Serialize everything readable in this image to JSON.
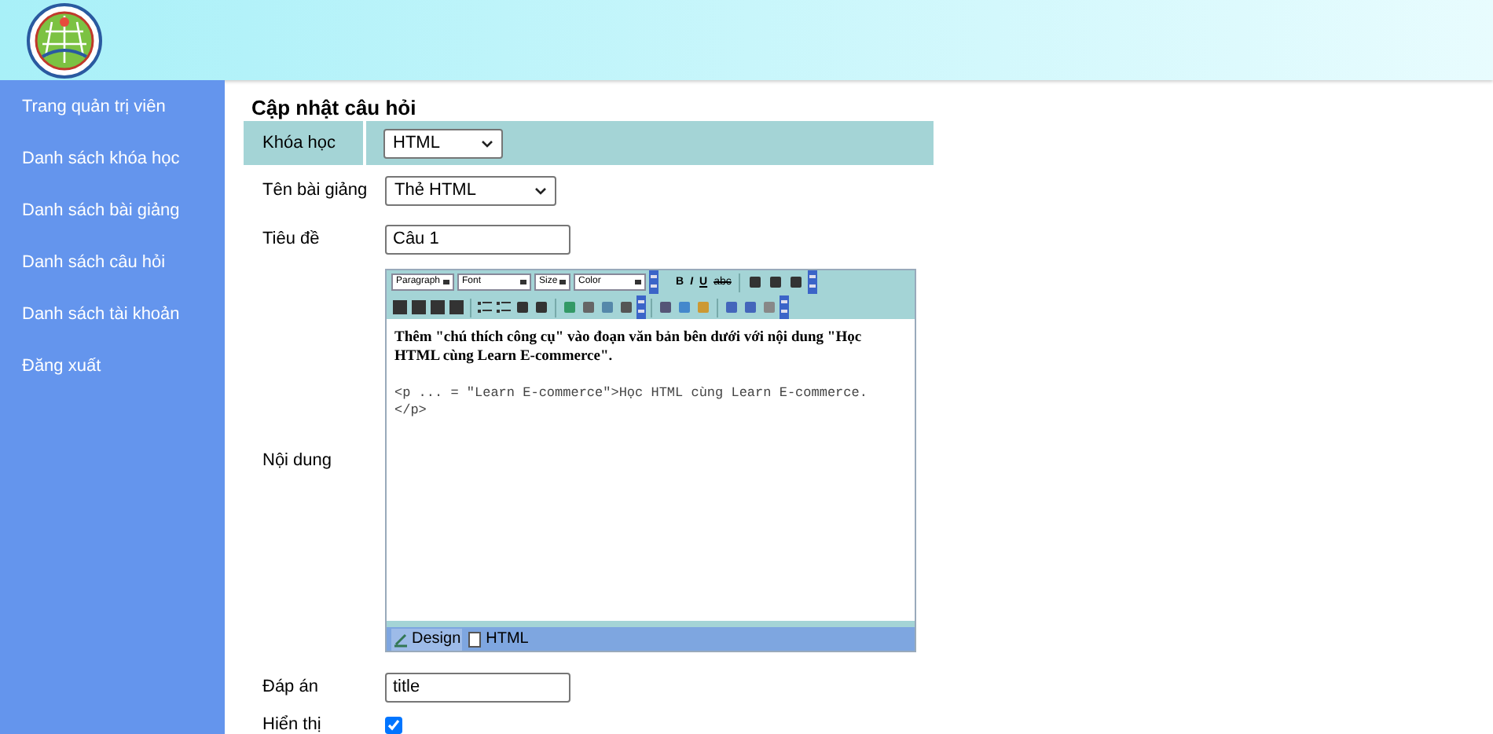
{
  "sidebar": {
    "items": [
      {
        "label": "Trang quản trị viên"
      },
      {
        "label": "Danh sách khóa học"
      },
      {
        "label": "Danh sách bài giảng"
      },
      {
        "label": "Danh sách câu hỏi"
      },
      {
        "label": "Danh sách tài khoản"
      },
      {
        "label": "Đăng xuất"
      }
    ]
  },
  "page_title": "Cập nhật câu hỏi",
  "form": {
    "course": {
      "label": "Khóa học",
      "value": "HTML"
    },
    "lesson": {
      "label": "Tên bài giảng",
      "value": "Thẻ HTML"
    },
    "title": {
      "label": "Tiêu đề",
      "value": "Câu 1"
    },
    "content": {
      "label": "Nội dung",
      "toolbar_selects": [
        "Paragraph",
        "Font",
        "Size",
        "Color"
      ],
      "toolbar_text_buttons": [
        {
          "label": "B",
          "kind": "bold"
        },
        {
          "label": "I",
          "kind": "italic"
        },
        {
          "label": "U",
          "kind": "underline"
        },
        {
          "label": "abc",
          "kind": "strike"
        }
      ],
      "paragraph": "Thêm \"chú thích công cụ\" vào đoạn văn bản bên dưới với nội dung \"Học HTML cùng Learn E-commerce\".",
      "code_lines": [
        "<p ... = \"Learn E-commerce\">Học HTML cùng Learn E-commerce.",
        "</p>"
      ],
      "tabs": [
        {
          "label": "Design",
          "selected": true
        },
        {
          "label": "HTML",
          "selected": false
        }
      ]
    },
    "answer": {
      "label": "Đáp án",
      "value": "title"
    },
    "visible": {
      "label": "Hiển thị",
      "checked": true
    }
  }
}
